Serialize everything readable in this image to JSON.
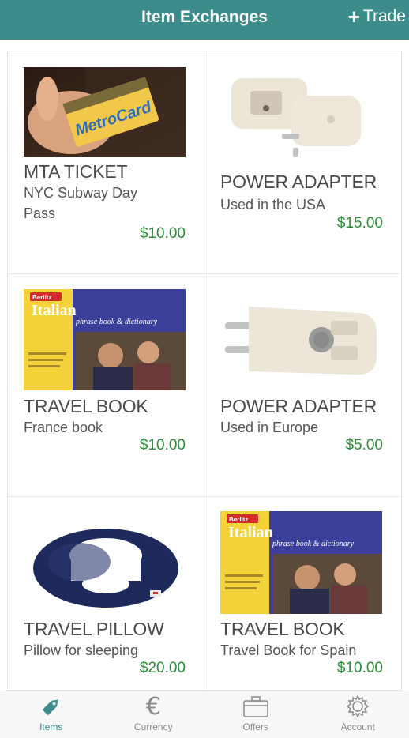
{
  "header": {
    "title": "Item Exchanges",
    "trade_label": "Trade"
  },
  "items": [
    {
      "title": "MTA TICKET",
      "desc": "NYC Subway Day Pass",
      "price": "$10.00",
      "image": "metrocard-photo"
    },
    {
      "title": "POWER ADAPTER",
      "desc": "Used in the USA",
      "price": "$15.00",
      "image": "us-power-adapter-photo"
    },
    {
      "title": "TRAVEL BOOK",
      "desc": "France book",
      "price": "$10.00",
      "image": "berlitz-italian-book-cover"
    },
    {
      "title": "POWER ADAPTER",
      "desc": "Used in Europe",
      "price": "$5.00",
      "image": "eu-power-adapter-photo"
    },
    {
      "title": "TRAVEL PILLOW",
      "desc": "Pillow for sleeping",
      "price": "$20.00",
      "image": "neck-pillow-photo"
    },
    {
      "title": "TRAVEL BOOK",
      "desc": "Travel Book for Spain",
      "price": "$10.00",
      "image": "berlitz-italian-book-cover"
    }
  ],
  "book_cover": {
    "brand": "Berlitz",
    "title": "Italian",
    "subtitle": "phrase book & dictionary"
  },
  "metrocard_text": "MetroCard",
  "tabs": [
    {
      "label": "Items",
      "icon": "tag-icon",
      "active": true
    },
    {
      "label": "Currency",
      "icon": "euro-icon",
      "active": false
    },
    {
      "label": "Offers",
      "icon": "briefcase-icon",
      "active": false
    },
    {
      "label": "Account",
      "icon": "gear-icon",
      "active": false
    }
  ],
  "colors": {
    "header": "#3d8c8c",
    "price": "#2e8b3a",
    "active_tab": "#3d8c8c"
  }
}
